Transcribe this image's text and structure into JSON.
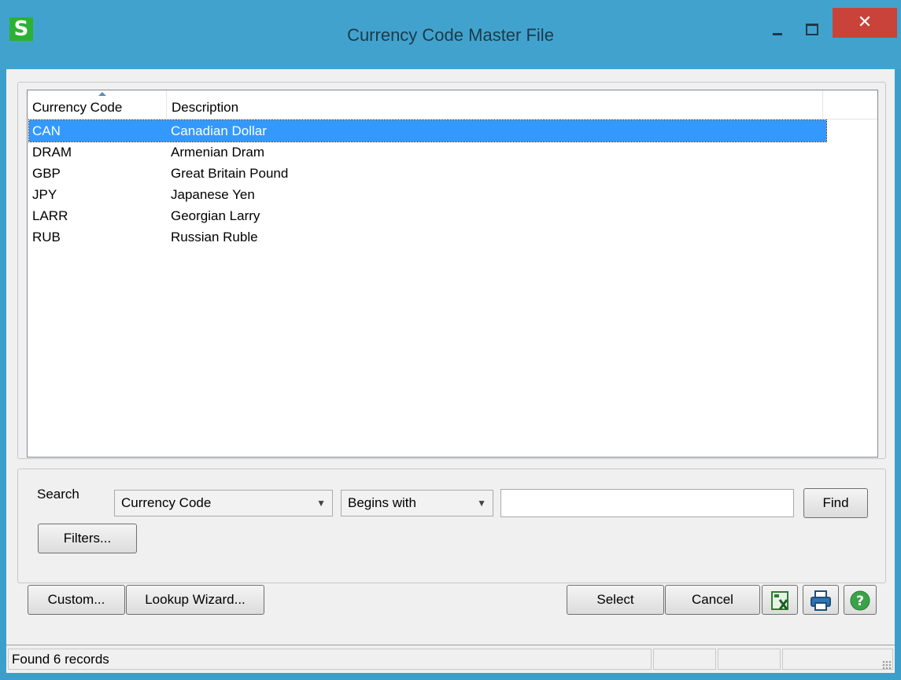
{
  "window": {
    "title": "Currency Code Master File",
    "app_icon": "S",
    "close_glyph": "✕"
  },
  "list": {
    "columns": [
      "Currency Code",
      "Description"
    ],
    "rows": [
      {
        "code": "CAN",
        "desc": "Canadian Dollar",
        "selected": true
      },
      {
        "code": "DRAM",
        "desc": "Armenian Dram"
      },
      {
        "code": "GBP",
        "desc": "Great Britain Pound"
      },
      {
        "code": "JPY",
        "desc": "Japanese Yen"
      },
      {
        "code": "LARR",
        "desc": "Georgian Larry"
      },
      {
        "code": "RUB",
        "desc": "Russian Ruble"
      }
    ]
  },
  "search": {
    "label": "Search",
    "field": "Currency Code",
    "operator": "Begins with",
    "value": "",
    "find_label": "Find",
    "filters_label": "Filters..."
  },
  "buttons": {
    "custom": "Custom...",
    "lookup_wizard": "Lookup Wizard...",
    "select": "Select",
    "cancel": "Cancel"
  },
  "icons": {
    "excel": "excel-icon",
    "print": "printer-icon",
    "help": "help-icon"
  },
  "colors": {
    "titlebar": "#41a3cd",
    "close": "#c9433a",
    "selection": "#3399ff",
    "app_icon": "#2db134"
  },
  "status": {
    "text": "Found 6 records"
  }
}
